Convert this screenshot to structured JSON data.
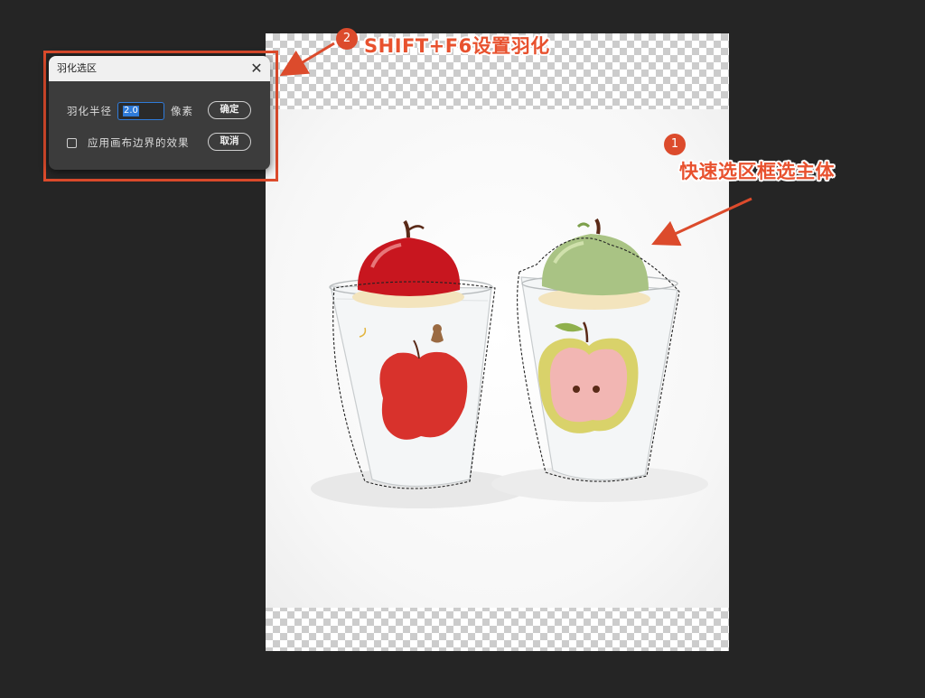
{
  "dialog": {
    "title": "羽化选区",
    "close_label": "✕",
    "radius_label": "羽化半径",
    "radius_value": "2.0",
    "unit_label": "像素",
    "ok_label": "确定",
    "cancel_label": "取消",
    "checkbox_label": "应用画布边界的效果",
    "checkbox_checked": false
  },
  "annotations": {
    "step1_number": "1",
    "step1_text": "快速选区框选主体",
    "step2_number": "2",
    "step2_text": "SHIFT+F6设置羽化",
    "color": "#dc4b2c"
  },
  "colors": {
    "background": "#252525",
    "dialog_bg": "#3c3c3c",
    "input_focus": "#2f7bd9"
  },
  "icons": [
    "close-icon",
    "checkbox-icon",
    "arrow-icon"
  ]
}
